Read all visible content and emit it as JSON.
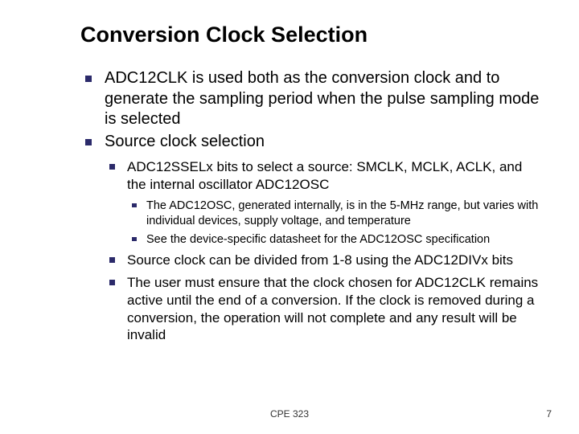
{
  "title": "Conversion Clock Selection",
  "bullets": {
    "b1": "ADC12CLK is used both as the conversion clock and to generate the sampling period when the pulse sampling mode is selected",
    "b2": "Source clock selection",
    "b2_1": "ADC12SSELx bits to select a source: SMCLK, MCLK, ACLK, and the internal oscillator ADC12OSC",
    "b2_1_1": "The ADC12OSC, generated internally, is in the 5-MHz range, but varies with individual devices, supply voltage, and temperature",
    "b2_1_2": "See the device-specific datasheet for the ADC12OSC specification",
    "b2_2": "Source clock can be divided from 1-8 using the ADC12DIVx bits",
    "b2_3": "The user must ensure that the clock chosen for ADC12CLK remains active until the end of a conversion. If the clock is removed during a conversion, the operation will not complete and any result will be invalid"
  },
  "footer": {
    "center": "CPE 323",
    "page": "7"
  }
}
